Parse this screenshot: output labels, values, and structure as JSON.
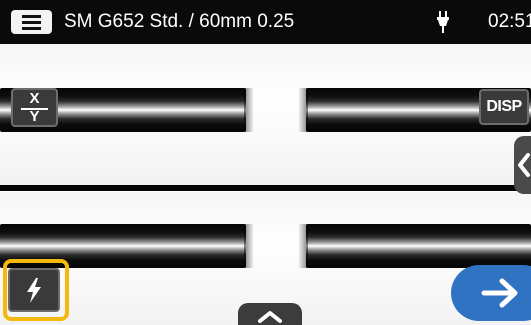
{
  "header": {
    "title": "SM G652 Std. / 60mm 0.25",
    "time": "02:51"
  },
  "buttons": {
    "xy_top": "X",
    "xy_bottom": "Y",
    "disp": "DISP"
  },
  "icons": {
    "menu": "hamburger-menu-icon",
    "power": "ac-plug-icon",
    "arc": "lightning-bolt-icon",
    "side_tab": "chevron-left-icon",
    "up_tab": "chevron-up-icon",
    "next": "arrow-right-icon"
  },
  "colors": {
    "topbar": "#0a0a0a",
    "highlight": "#f5b90e",
    "next_button": "#2f73c2",
    "overlay_button": "#3a3a3a"
  }
}
